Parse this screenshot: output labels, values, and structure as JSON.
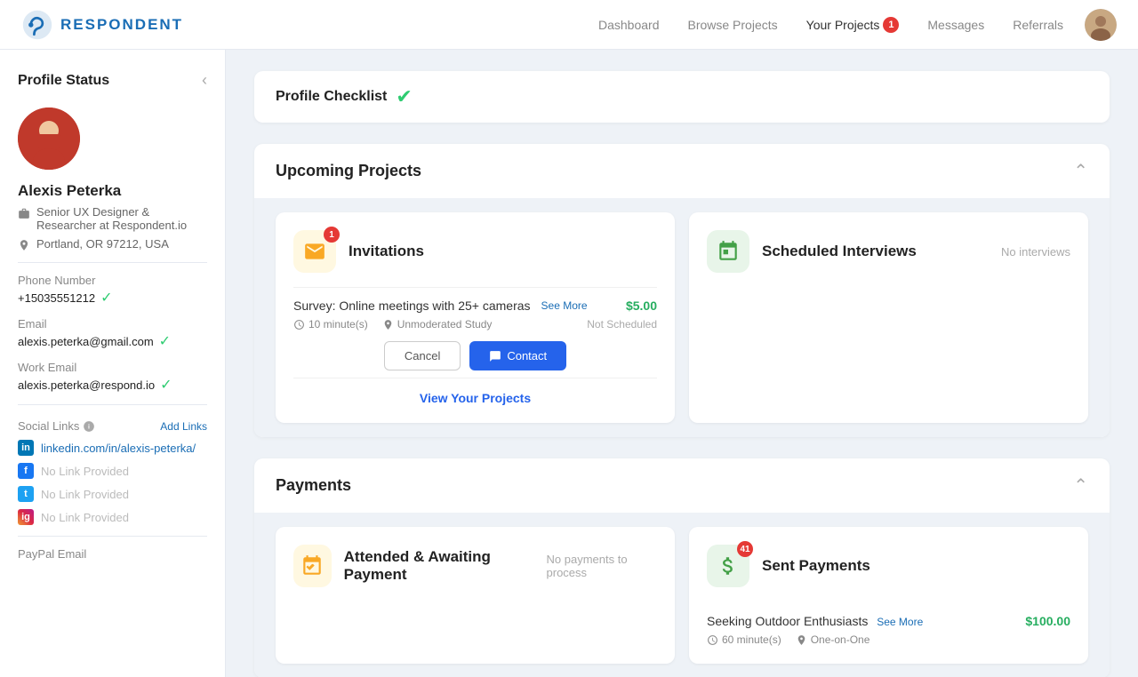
{
  "nav": {
    "logo_text": "RESPONDENT",
    "links": [
      {
        "label": "Dashboard",
        "active": false,
        "badge": null
      },
      {
        "label": "Browse Projects",
        "active": false,
        "badge": null
      },
      {
        "label": "Your Projects",
        "active": true,
        "badge": "1"
      },
      {
        "label": "Messages",
        "active": false,
        "badge": null
      },
      {
        "label": "Referrals",
        "active": false,
        "badge": null
      }
    ]
  },
  "sidebar": {
    "title": "Profile Status",
    "name": "Alexis Peterka",
    "job_title": "Senior UX Designer & Researcher at Respondent.io",
    "location": "Portland, OR 97212, USA",
    "phone_label": "Phone Number",
    "phone": "+15035551212",
    "email_label": "Email",
    "email": "alexis.peterka@gmail.com",
    "work_email_label": "Work Email",
    "work_email": "alexis.peterka@respond.io",
    "social_label": "Social Links",
    "add_links_label": "Add Links",
    "linkedin": "linkedin.com/in/alexis-peterka/",
    "facebook": "No Link Provided",
    "twitter": "No Link Provided",
    "instagram": "No Link Provided",
    "paypal_label": "PayPal Email"
  },
  "checklist": {
    "title": "Profile Checklist"
  },
  "upcoming": {
    "title": "Upcoming Projects"
  },
  "invitations": {
    "label": "Invitations",
    "badge": "1",
    "survey_title": "Survey: Online meetings with 25+ cameras",
    "see_more": "See More",
    "price": "$5.00",
    "duration": "10 minute(s)",
    "type": "Unmoderated Study",
    "status": "Not Scheduled",
    "cancel_btn": "Cancel",
    "contact_btn": "Contact",
    "view_projects": "View Your Projects"
  },
  "scheduled": {
    "label": "Scheduled Interviews",
    "sub": "No interviews"
  },
  "payments": {
    "title": "Payments",
    "awaiting_label": "Attended & Awaiting Payment",
    "awaiting_sub": "No payments to process",
    "sent_label": "Sent Payments",
    "sent_badge": "41",
    "sent_title": "Seeking Outdoor Enthusiasts",
    "sent_see_more": "See More",
    "sent_price": "$100.00",
    "sent_duration": "60 minute(s)",
    "sent_type": "One-on-One"
  }
}
